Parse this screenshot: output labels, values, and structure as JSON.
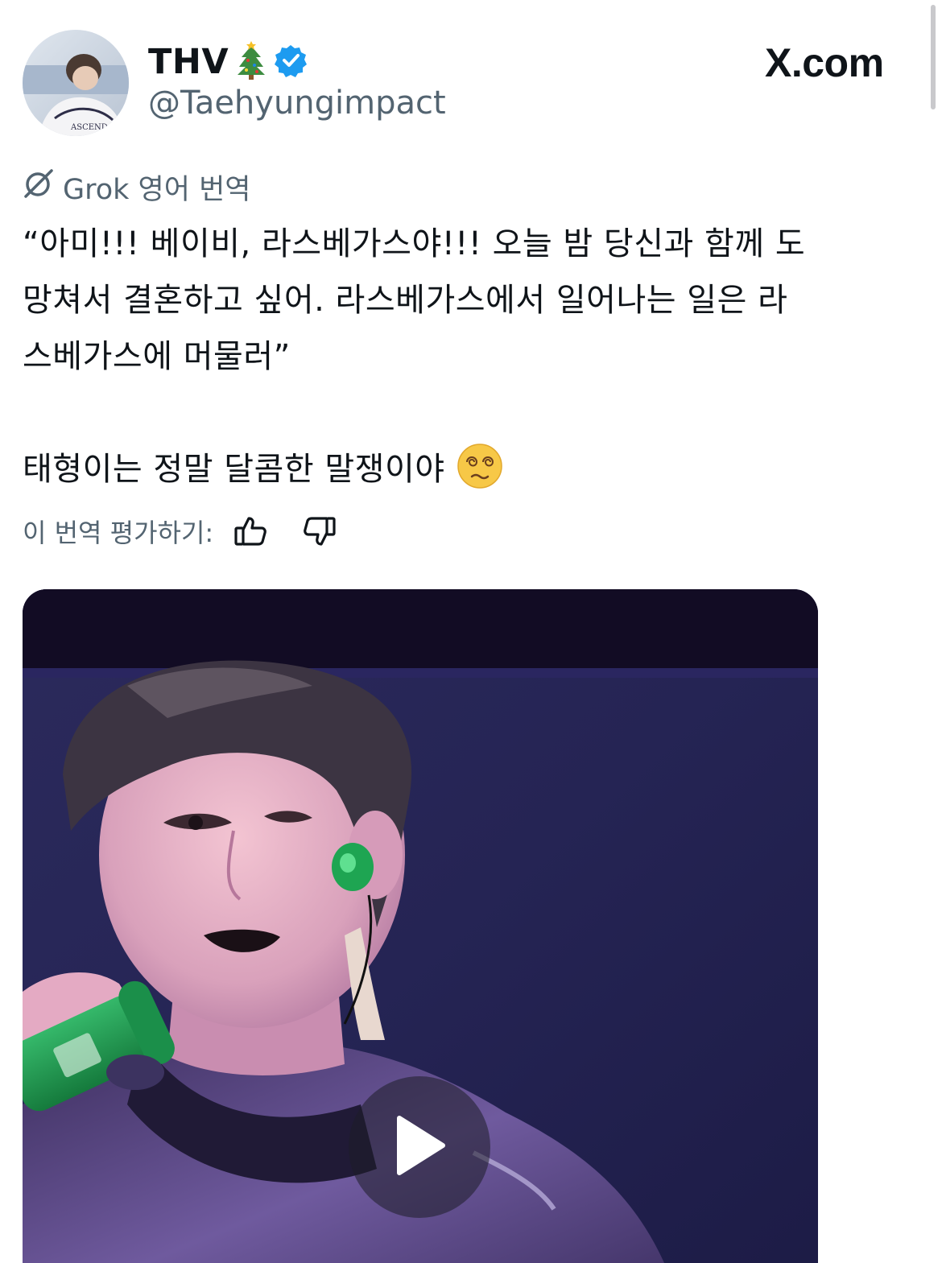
{
  "author": {
    "display_name": "THV",
    "name_emoji": "christmas-tree-icon",
    "verified_badge": "verified-badge-icon",
    "handle": "@Taehyungimpact",
    "avatar_text": "ASCEND"
  },
  "header": {
    "brand": "X.com"
  },
  "translation": {
    "label": "Grok 영어 번역",
    "icon": "grok-icon"
  },
  "tweet": {
    "line1": "“아미!!! 베이비, 라스베가스야!!! 오늘 밤 당신과 함께 도",
    "line2": "망쳐서 결혼하고 싶어. 라스베가스에서 일어나는 일은 라",
    "line3": "스베가스에 머물러”",
    "comment": "태형이는 정말 달콤한 말쟁이야",
    "comment_emoji": "face-with-spiral-eyes-icon"
  },
  "rating": {
    "label": "이 번역 평가하기:",
    "like_icon": "thumbs-up-icon",
    "dislike_icon": "thumbs-down-icon"
  },
  "media": {
    "type": "video",
    "play_icon": "play-icon"
  },
  "colors": {
    "text_primary": "#0f1419",
    "text_secondary": "#536471",
    "verified_blue": "#1d9bf0",
    "media_background": "#1e1a3a"
  }
}
